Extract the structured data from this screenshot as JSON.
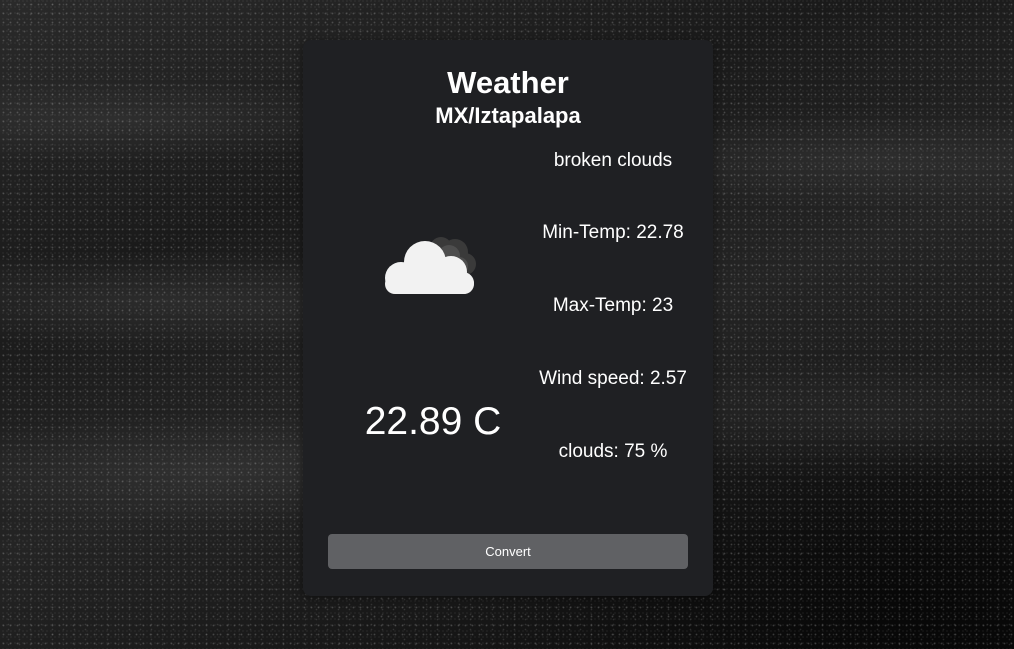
{
  "weather": {
    "title": "Weather",
    "location": "MX/Iztapalapa",
    "temperature": "22.89 C",
    "description": "broken clouds",
    "min_temp": "Min-Temp: 22.78",
    "max_temp": "Max-Temp: 23",
    "wind_speed": "Wind speed: 2.57",
    "clouds": "clouds: 75 %",
    "icon": "broken-clouds-icon"
  },
  "actions": {
    "convert_label": "Convert"
  },
  "colors": {
    "card_background": "#1f2023",
    "button_background": "#606164",
    "text": "#ffffff"
  }
}
